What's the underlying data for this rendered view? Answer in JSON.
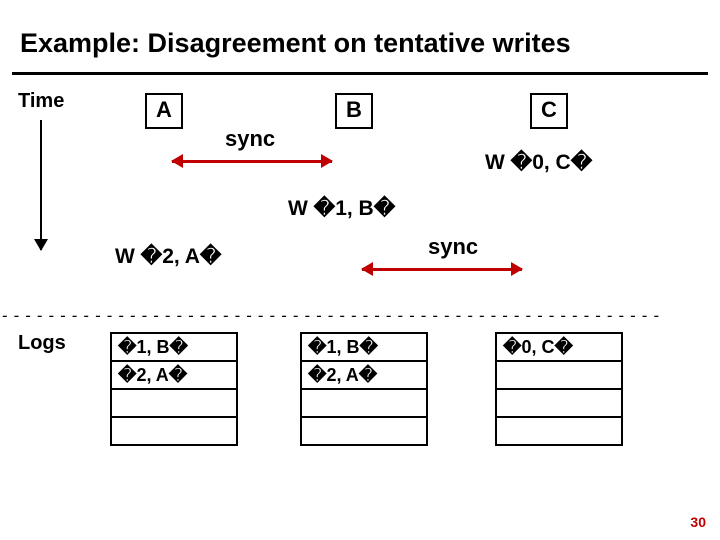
{
  "title": "Example: Disagreement on tentative writes",
  "time_label": "Time",
  "logs_label": "Logs",
  "nodes": {
    "a": "A",
    "b": "B",
    "c": "C"
  },
  "sync_label_1": "sync",
  "sync_label_2": "sync",
  "events": {
    "w0c": "W �0, C�",
    "w1b": "W �1, B�",
    "w2a": "W �2, A�"
  },
  "separator": "---------------------------------------------------------",
  "log_a": [
    "�1, B�",
    "�2, A�",
    "",
    ""
  ],
  "log_b": [
    "�1, B�",
    "�2, A�",
    "",
    ""
  ],
  "log_c": [
    "�0, C�",
    "",
    "",
    ""
  ],
  "page_number": "30"
}
